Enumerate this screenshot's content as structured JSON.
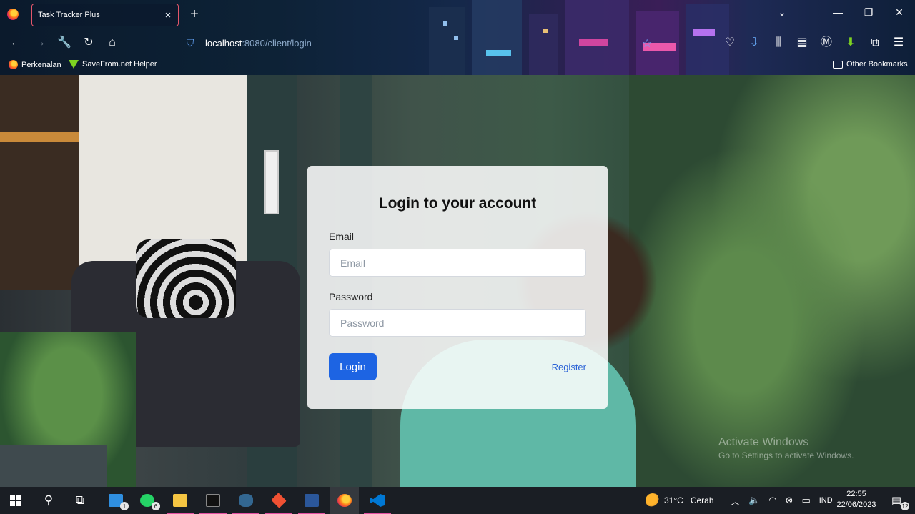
{
  "browser": {
    "tab_title": "Task Tracker Plus",
    "tab_close": "×",
    "new_tab": "+",
    "url_host": "localhost",
    "url_rest": ":8080/client/login",
    "bookmarks": [
      "Perkenalan",
      "SaveFrom.net Helper"
    ],
    "other_bookmarks": "Other Bookmarks",
    "window_controls": {
      "minimize": "—",
      "restore": "❐",
      "close": "✕"
    },
    "chevron": "⌄"
  },
  "login": {
    "title": "Login to your account",
    "email_label": "Email",
    "email_placeholder": "Email",
    "password_label": "Password",
    "password_placeholder": "Password",
    "login_button": "Login",
    "register_link": "Register"
  },
  "watermark": {
    "line1": "Activate Windows",
    "line2": "Go to Settings to activate Windows."
  },
  "taskbar": {
    "mail_badge": "1",
    "whatsapp_badge": "6",
    "weather": "31°C",
    "weather_desc": "Cerah",
    "language": "IND",
    "time": "22:55",
    "date": "22/06/2023",
    "notif_count": "12"
  },
  "colors": {
    "accent": "#1d64e3",
    "link": "#2a62d6",
    "tab_border": "#e3566b"
  }
}
